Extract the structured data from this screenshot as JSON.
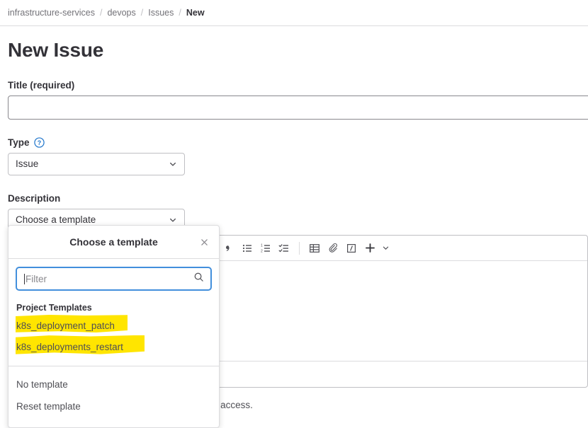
{
  "breadcrumb": {
    "items": [
      {
        "label": "infrastructure-services",
        "current": false
      },
      {
        "label": "devops",
        "current": false
      },
      {
        "label": "Issues",
        "current": false
      },
      {
        "label": "New",
        "current": true
      }
    ],
    "separator": "/"
  },
  "page": {
    "title": "New Issue"
  },
  "form": {
    "title_label": "Title (required)",
    "title_value": "",
    "title_placeholder": "",
    "type_label": "Type",
    "type_help_icon": "question-circle-icon",
    "type_value": "Issue",
    "description_label": "Description",
    "template_select_value": "Choose a template",
    "chevron_icon": "chevron-down-icon"
  },
  "editor": {
    "body_value": "",
    "toolbar": [
      {
        "name": "blockquote-icon",
        "glyph": "”"
      },
      {
        "name": "bullet-list-icon",
        "glyph": "list-ul"
      },
      {
        "name": "numbered-list-icon",
        "glyph": "list-ol"
      },
      {
        "name": "task-list-icon",
        "glyph": "list-check"
      },
      {
        "name": "table-icon",
        "glyph": "table"
      },
      {
        "name": "attachment-icon",
        "glyph": "paperclip"
      },
      {
        "name": "code-block-icon",
        "glyph": "code-box"
      },
      {
        "name": "add-more-icon",
        "glyph": "plus"
      },
      {
        "name": "chevron-down-icon",
        "glyph": "chevron"
      }
    ]
  },
  "help_text": "be visible to team members with at least Reporter access.",
  "template_dropdown": {
    "header_title": "Choose a template",
    "close_icon": "close-icon",
    "filter_placeholder": "Filter",
    "filter_value": "",
    "search_icon": "search-icon",
    "group_label": "Project Templates",
    "items": [
      {
        "label": "k8s_deployment_patch",
        "highlighted": true
      },
      {
        "label": "k8s_deployments_restart",
        "highlighted": true
      }
    ],
    "footer_items": [
      {
        "label": "No template"
      },
      {
        "label": "Reset template"
      }
    ]
  },
  "colors": {
    "highlight": "#ffe500",
    "focus_blue": "#428fdc",
    "text": "#333238",
    "muted_text": "#737278",
    "border": "#bfbfc3"
  }
}
